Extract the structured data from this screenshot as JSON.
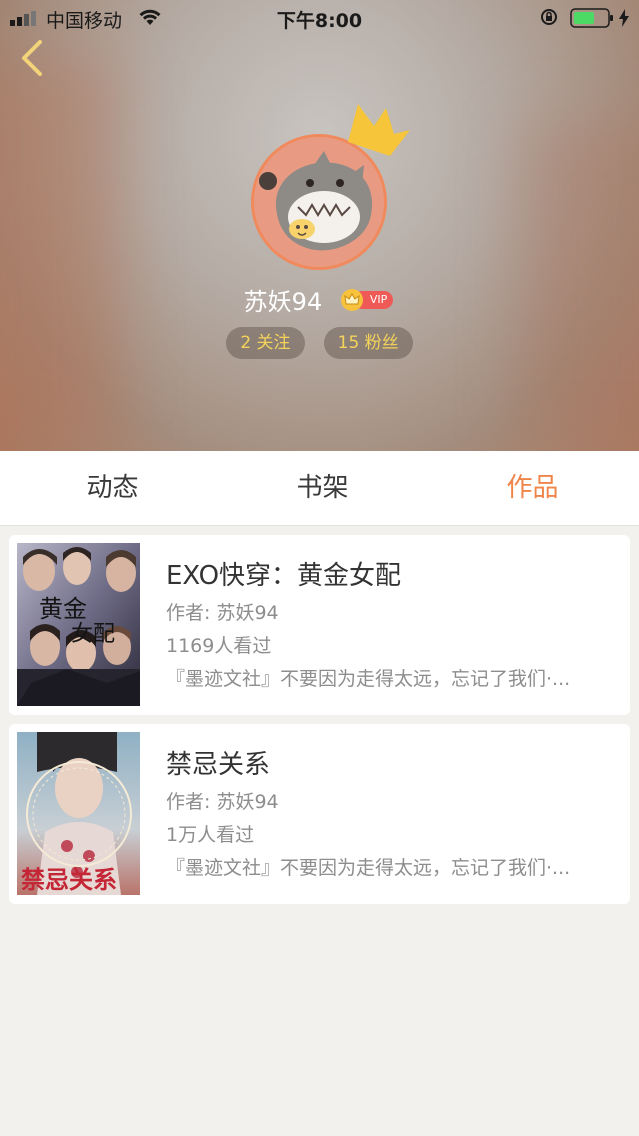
{
  "status_bar": {
    "carrier": "中国移动",
    "time": "下午8:00"
  },
  "profile": {
    "username": "苏妖94",
    "vip_label": "VIP",
    "following": "2 关注",
    "followers": "15 粉丝"
  },
  "tabs": [
    {
      "label": "动态",
      "active": false
    },
    {
      "label": "书架",
      "active": false
    },
    {
      "label": "作品",
      "active": true
    }
  ],
  "books": [
    {
      "title": "EXO快穿：黄金女配",
      "author": "作者: 苏妖94",
      "views": "1169人看过",
      "description": "『墨迹文社』不要因为走得太远，忘记了我们·..."
    },
    {
      "title": "禁忌关系",
      "author": "作者: 苏妖94",
      "views": "1万人看过",
      "description": "『墨迹文社』不要因为走得太远，忘记了我们·..."
    }
  ],
  "colors": {
    "accent": "#f0854a",
    "stat_text": "#f5d35b",
    "vip_red": "#ef5a56"
  }
}
